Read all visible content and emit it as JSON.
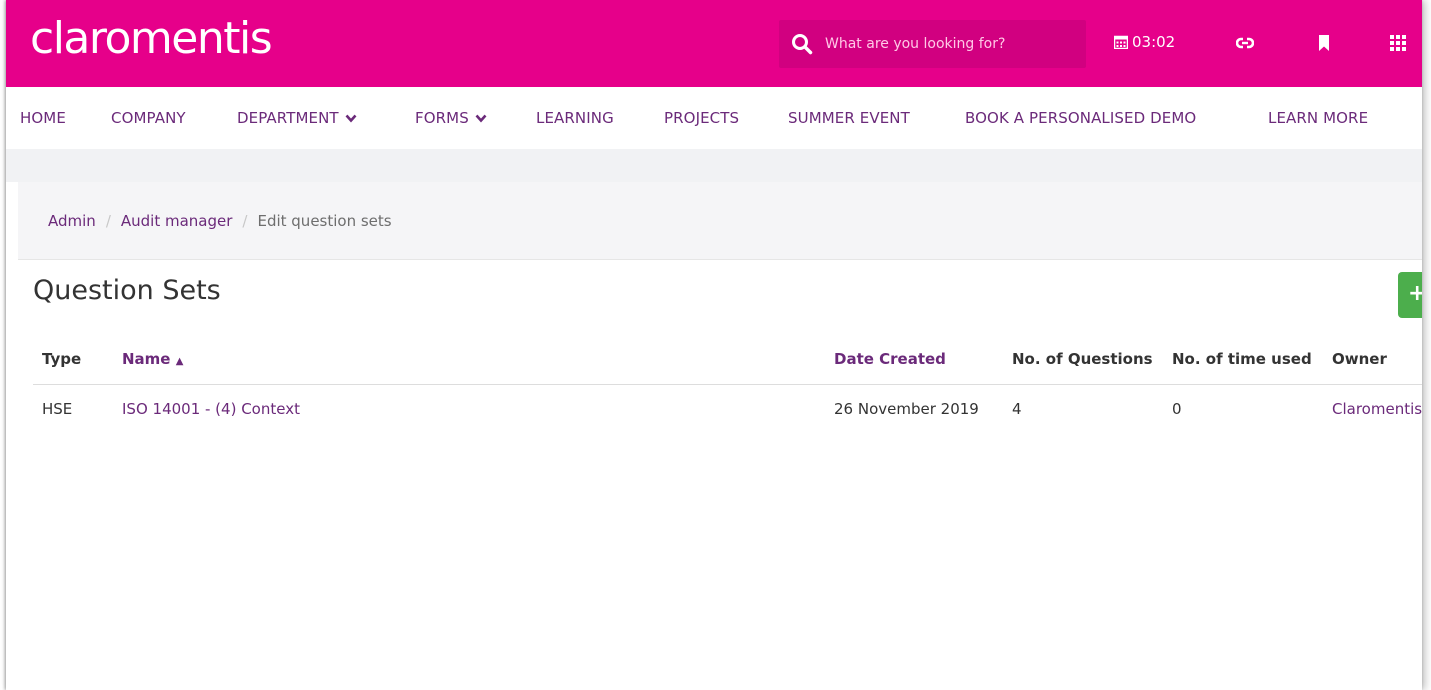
{
  "header": {
    "logo": "claromentis",
    "search_placeholder": "What are you looking for?",
    "time": "03:02",
    "accent_color": "#e6008a"
  },
  "nav": {
    "items": [
      {
        "label": "HOME",
        "dropdown": false
      },
      {
        "label": "COMPANY",
        "dropdown": false
      },
      {
        "label": "DEPARTMENT",
        "dropdown": true
      },
      {
        "label": "FORMS",
        "dropdown": true
      },
      {
        "label": "LEARNING",
        "dropdown": false
      },
      {
        "label": "PROJECTS",
        "dropdown": false
      },
      {
        "label": "SUMMER EVENT",
        "dropdown": false
      },
      {
        "label": "BOOK A PERSONALISED DEMO",
        "dropdown": false
      },
      {
        "label": "LEARN MORE",
        "dropdown": false
      }
    ]
  },
  "breadcrumb": {
    "items": [
      "Admin",
      "Audit manager",
      "Edit question sets"
    ],
    "separator": "/"
  },
  "page": {
    "title": "Question Sets",
    "add_button_label": "+"
  },
  "table": {
    "columns": [
      "Type",
      "Name",
      "Date Created",
      "No. of Questions",
      "No. of time used",
      "Owner"
    ],
    "sort_indicator": "▲",
    "rows": [
      {
        "type": "HSE",
        "name": "ISO 14001 - (4) Context",
        "date_created": "26 November 2019",
        "questions": "4",
        "times_used": "0",
        "owner": "Claromentis"
      }
    ]
  },
  "icons": {
    "search": "search-icon",
    "calendar": "calendar-icon",
    "link": "link-icon",
    "bookmark": "bookmark-icon",
    "apps": "apps-grid-icon",
    "sort": "sort-asc-icon",
    "chevron": "chevron-down-icon"
  }
}
